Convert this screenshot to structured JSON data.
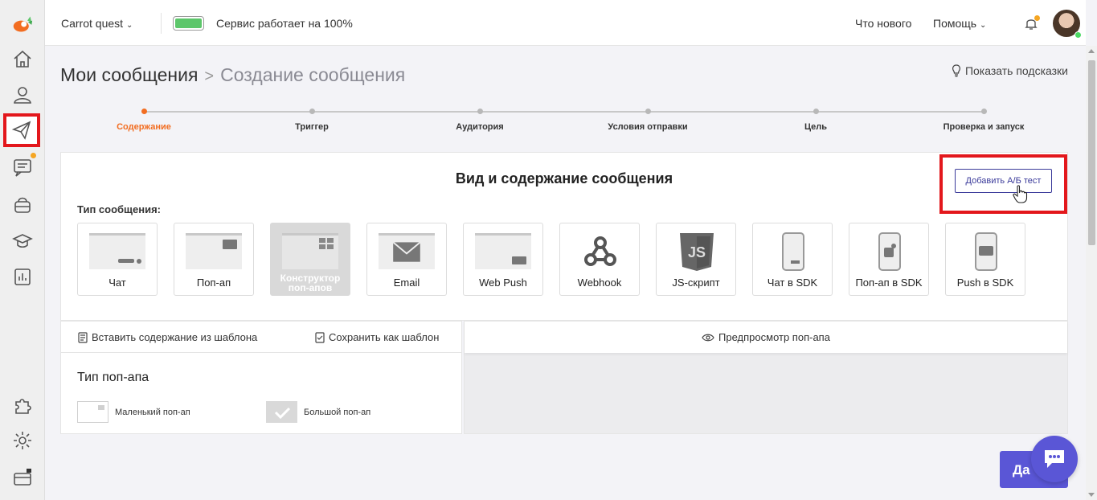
{
  "header": {
    "project": "Carrot quest",
    "status": "Сервис работает на 100%",
    "whats_new": "Что нового",
    "help": "Помощь"
  },
  "breadcrumb": {
    "current": "Мои сообщения",
    "separator": ">",
    "next": "Создание сообщения"
  },
  "hints_link": "Показать подсказки",
  "stepper": {
    "steps": [
      {
        "label": "Содержание",
        "active": true
      },
      {
        "label": "Триггер",
        "active": false
      },
      {
        "label": "Аудитория",
        "active": false
      },
      {
        "label": "Условия отправки",
        "active": false
      },
      {
        "label": "Цель",
        "active": false
      },
      {
        "label": "Проверка и запуск",
        "active": false
      }
    ]
  },
  "card": {
    "title": "Вид и содержание сообщения",
    "ab_button": "Добавить А/Б тест",
    "type_label": "Тип сообщения:",
    "types": [
      {
        "label": "Чат",
        "icon": "chat-preview-icon"
      },
      {
        "label": "Поп-ап",
        "icon": "popup-preview-icon"
      },
      {
        "label": "Конструктор поп-апов",
        "icon": "popup-builder-icon",
        "selected": true
      },
      {
        "label": "Email",
        "icon": "email-icon"
      },
      {
        "label": "Web Push",
        "icon": "web-push-icon"
      },
      {
        "label": "Webhook",
        "icon": "webhook-icon"
      },
      {
        "label": "JS-скрипт",
        "icon": "js-icon"
      },
      {
        "label": "Чат в SDK",
        "icon": "sdk-chat-icon"
      },
      {
        "label": "Поп-ап в SDK",
        "icon": "sdk-popup-icon"
      },
      {
        "label": "Push в SDK",
        "icon": "sdk-push-icon"
      }
    ]
  },
  "editor": {
    "insert_template": "Вставить содержание из шаблона",
    "save_template": "Сохранить как шаблон",
    "preview": "Предпросмотр поп-апа",
    "popup_type_title": "Тип поп-апа",
    "small_popup": "Маленький поп-ап",
    "big_popup": "Большой поп-ап"
  },
  "next_button": "Да",
  "colors": {
    "accent": "#5a56d6",
    "active_step": "#f26d21",
    "highlight": "#e3171c",
    "status_ok": "#5cc66a"
  }
}
